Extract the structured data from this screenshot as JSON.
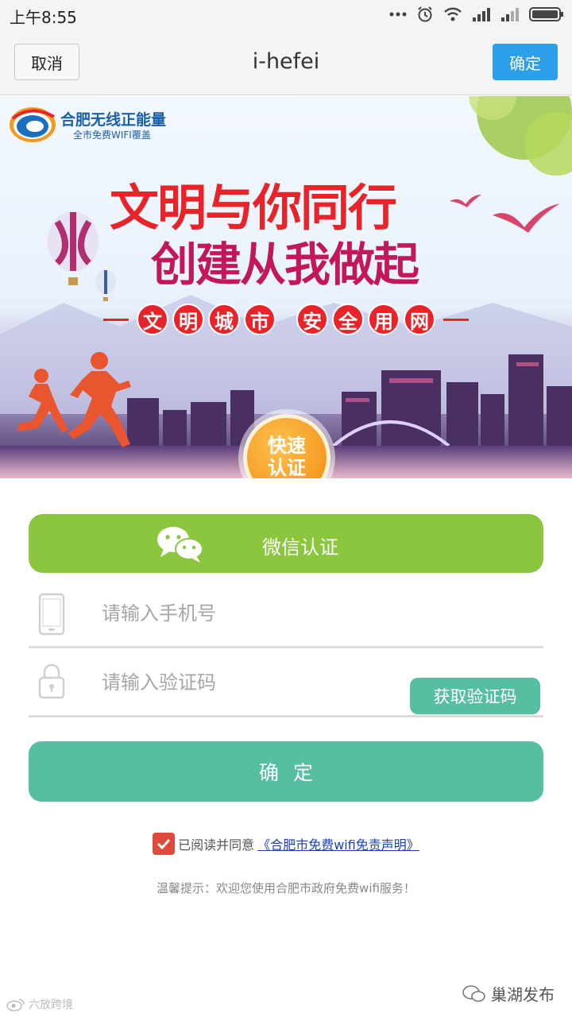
{
  "status_bar": {
    "time": "上午8:55"
  },
  "nav": {
    "cancel_label": "取消",
    "title": "i-hefei",
    "confirm_label": "确定"
  },
  "banner": {
    "logo_title": "合肥无线正能量",
    "logo_subtitle": "全市免费WIFI覆盖",
    "slogan_line1": "文明与你同行",
    "slogan_line2": "创建从我做起",
    "tags_left": [
      "文",
      "明",
      "城",
      "市"
    ],
    "tags_right": [
      "安",
      "全",
      "用",
      "网"
    ],
    "badge_line1": "快速",
    "badge_line2": "认证"
  },
  "form": {
    "wechat_label": "微信认证",
    "phone_placeholder": "请输入手机号",
    "code_placeholder": "请输入验证码",
    "get_code_label": "获取验证码",
    "submit_label": "确定",
    "agree_prefix": "已阅读并同意",
    "agree_link": "《合肥市免费wifi免责声明》",
    "agree_checked": true,
    "tip": "温馨提示：欢迎您使用合肥市政府免费wifi服务！"
  },
  "watermarks": {
    "left": "六放跨境",
    "right": "巢湖发布"
  },
  "colors": {
    "confirm_blue": "#2d9ee8",
    "wechat_green": "#8cc63e",
    "teal": "#56bfa2",
    "check_red": "#e04a3c",
    "link_blue": "#1d3fb5"
  }
}
